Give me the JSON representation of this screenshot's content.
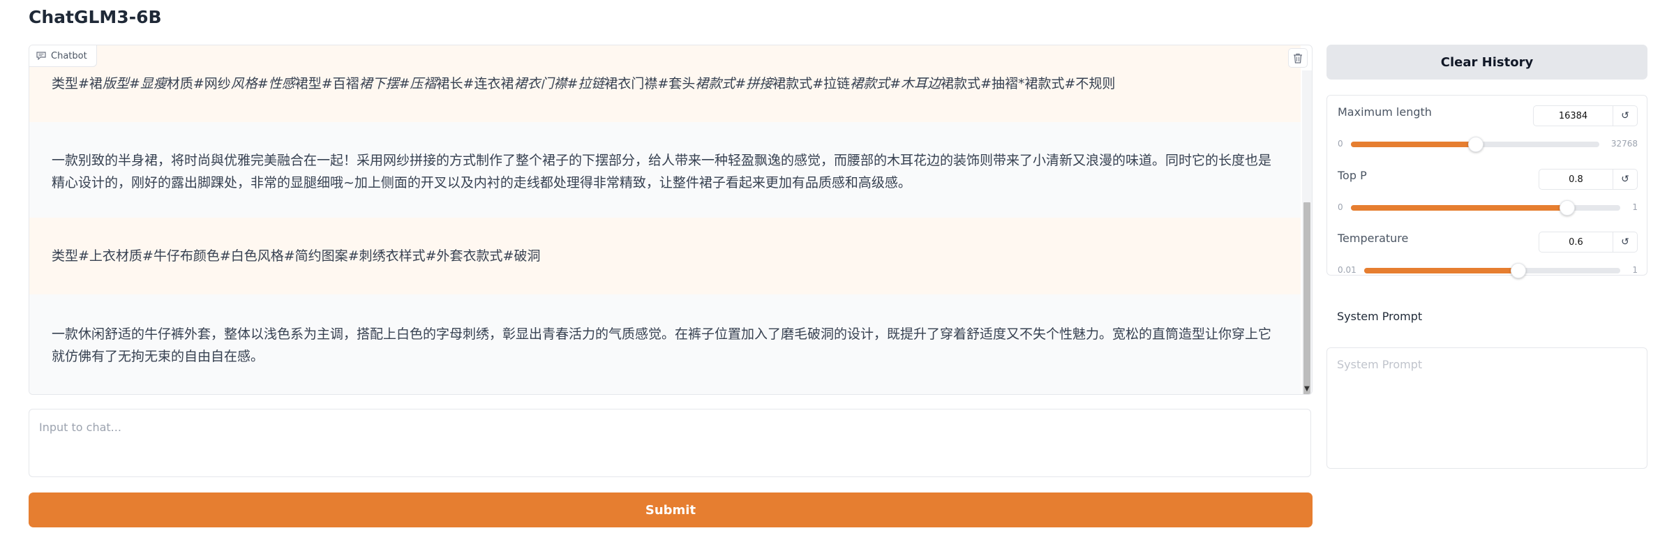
{
  "app": {
    "title": "ChatGLM3-6B"
  },
  "chatbot": {
    "label": "Chatbot",
    "messages": [
      {
        "role": "user",
        "segments": [
          {
            "text": "类型#裙",
            "italic": false
          },
          {
            "text": "版型#显瘦",
            "italic": true
          },
          {
            "text": "材质#网纱",
            "italic": false
          },
          {
            "text": "风格#性感",
            "italic": true
          },
          {
            "text": "裙型#百褶",
            "italic": false
          },
          {
            "text": "裙下摆#压褶",
            "italic": true
          },
          {
            "text": "裙长#连衣裙",
            "italic": false
          },
          {
            "text": "裙衣门襟#拉链",
            "italic": true
          },
          {
            "text": "裙衣门襟#套头",
            "italic": false
          },
          {
            "text": "裙款式#拼接",
            "italic": true
          },
          {
            "text": "裙款式#拉链",
            "italic": false
          },
          {
            "text": "裙款式#木耳边",
            "italic": true
          },
          {
            "text": "裙款式#抽褶*裙款式#不规则",
            "italic": false
          }
        ]
      },
      {
        "role": "bot",
        "text": "一款别致的半身裙，将时尚與优雅完美融合在一起！采用网纱拼接的方式制作了整个裙子的下摆部分，给人带来一种轻盈飘逸的感觉，而腰部的木耳花边的装饰则带来了小清新又浪漫的味道。同时它的长度也是精心设计的，刚好的露出脚踝处，非常的显腿细哦~加上侧面的开叉以及内衬的走线都处理得非常精致，让整件裙子看起来更加有品质感和高级感。"
      },
      {
        "role": "user",
        "text": "类型#上衣材质#牛仔布颜色#白色风格#简约图案#刺绣衣样式#外套衣款式#破洞"
      },
      {
        "role": "bot",
        "text": "一款休闲舒适的牛仔裤外套，整体以浅色系为主调，搭配上白色的字母刺绣，彰显出青春活力的气质感觉。在裤子位置加入了磨毛破洞的设计，既提升了穿着舒适度又不失个性魅力。宽松的直筒造型让你穿上它就仿佛有了无拘无束的自由自在感。"
      }
    ]
  },
  "input": {
    "placeholder": "Input to chat..."
  },
  "submit": {
    "label": "Submit"
  },
  "clear": {
    "label": "Clear History"
  },
  "params": {
    "max_length": {
      "label": "Maximum length",
      "value": "16384",
      "min": "0",
      "max": "32768",
      "fraction": 0.5
    },
    "top_p": {
      "label": "Top P",
      "value": "0.8",
      "min": "0",
      "max": "1",
      "fraction": 0.8
    },
    "temperature": {
      "label": "Temperature",
      "value": "0.6",
      "min": "0.01",
      "max": "1",
      "fraction": 0.6
    }
  },
  "system_prompt": {
    "label": "System Prompt",
    "placeholder": "System Prompt"
  },
  "colors": {
    "accent": "#e67e30",
    "user_bg": "#fff8f1",
    "bot_bg": "#f9fafb"
  }
}
